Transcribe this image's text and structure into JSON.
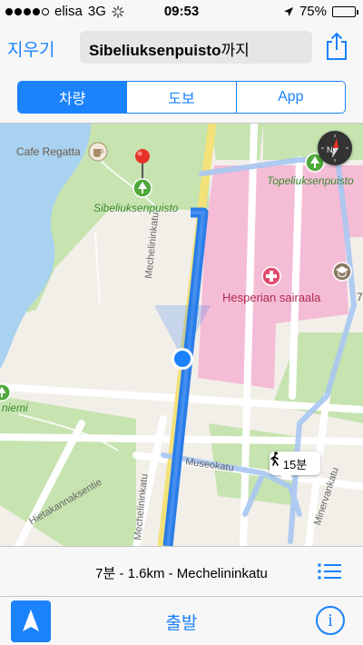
{
  "status_bar": {
    "carrier": "elisa",
    "network": "3G",
    "time": "09:53",
    "battery": "75%",
    "battery_level": 0.75,
    "signal_bars_filled": 4,
    "signal_bars_total": 5
  },
  "nav": {
    "clear_label": "지우기",
    "destination": "Sibeliuksenpuisto",
    "destination_suffix": "까지"
  },
  "segments": [
    {
      "label": "차량",
      "selected": true
    },
    {
      "label": "도보",
      "selected": false
    },
    {
      "label": "App",
      "selected": false
    }
  ],
  "map": {
    "places": {
      "cafe": "Cafe Regatta",
      "park": "Sibeliuksenpuisto",
      "park_right": "Topeliuksenpuisto",
      "hospital": "Hesperian sairaala",
      "park_left_partial": "niemi",
      "right_edge_partial": "7"
    },
    "streets": {
      "main": "Mechelininkatu",
      "main_lower": "Mechelininkatu",
      "museo": "Museokatu",
      "hietaranta": "Hietakannaksentie",
      "minerva": "Minervankatu"
    },
    "walk_callout": "15분",
    "icons": [
      "compass-icon",
      "pin-icon",
      "tree-icon",
      "hospital-icon",
      "university-icon",
      "cafe-icon",
      "walk-icon"
    ]
  },
  "route_summary": "7분 - 1.6km - Mechelininkatu",
  "toolbar": {
    "start_label": "출발",
    "info_label": "i"
  },
  "colors": {
    "accent": "#1a82fb",
    "route": "#2a7de8",
    "water": "#a8d2f0",
    "park": "#c6e3b0",
    "hospital": "#f5bcd6",
    "map_bg": "#f2efe9"
  }
}
